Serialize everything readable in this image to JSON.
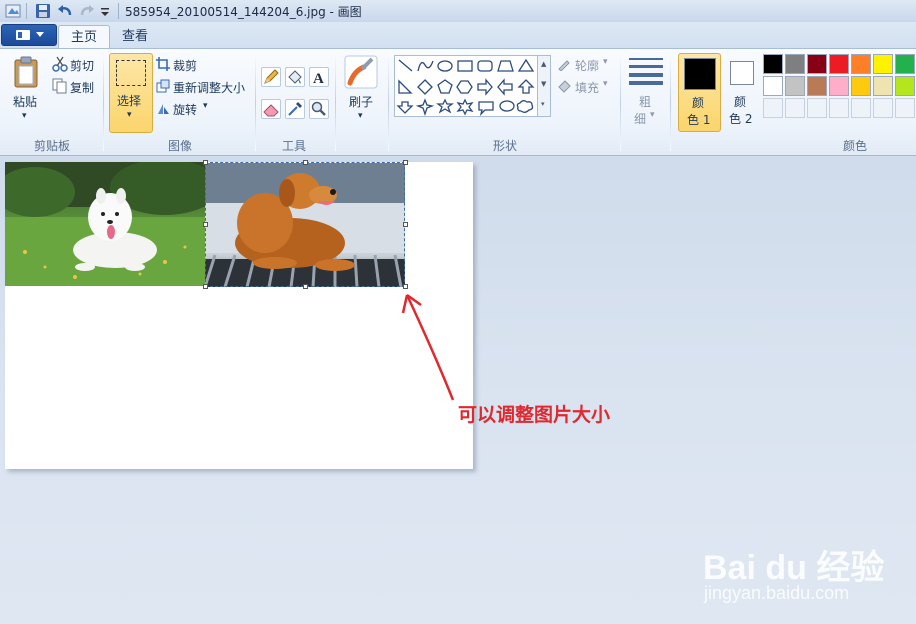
{
  "window": {
    "title": "585954_20100514_144204_6.jpg - 画图"
  },
  "quick_access": [
    "save-icon",
    "undo-icon",
    "redo-icon",
    "customize-icon"
  ],
  "tabs": [
    {
      "label": "主页",
      "active": true
    },
    {
      "label": "查看",
      "active": false
    }
  ],
  "ribbon": {
    "clipboard": {
      "paste": "粘贴",
      "cut": "剪切",
      "copy": "复制",
      "group_label": "剪贴板"
    },
    "image": {
      "select": "选择",
      "crop": "裁剪",
      "resize": "重新调整大小",
      "rotate": "旋转",
      "group_label": "图像"
    },
    "tools": {
      "group_label": "工具",
      "items": [
        "pencil-icon",
        "fill-icon",
        "text-icon",
        "eraser-icon",
        "color-picker-icon",
        "magnifier-icon"
      ]
    },
    "brushes": {
      "label": "刷子"
    },
    "shapes": {
      "group_label": "形状",
      "outline": "轮廓",
      "fill": "填充"
    },
    "size": {
      "label_line1": "粗",
      "label_line2": "细"
    },
    "colors": {
      "color1_line1": "颜",
      "color1_line2": "色 1",
      "color2_line1": "颜",
      "color2_line2": "色 2",
      "group_label": "颜色",
      "color1_value": "#000000",
      "color2_value": "#ffffff",
      "palette_row1": [
        "#000000",
        "#7f7f7f",
        "#880015",
        "#ed1c24",
        "#ff7f27",
        "#fff200",
        "#22b14c"
      ],
      "palette_row2": [
        "#ffffff",
        "#c3c3c3",
        "#b97a57",
        "#ffaec9",
        "#ffc90e",
        "#efe4b0",
        "#b5e61d"
      ]
    }
  },
  "canvas": {
    "annotation": "可以调整图片大小"
  },
  "watermark": {
    "brand": "Bai du 经验",
    "url": "jingyan.baidu.com"
  }
}
